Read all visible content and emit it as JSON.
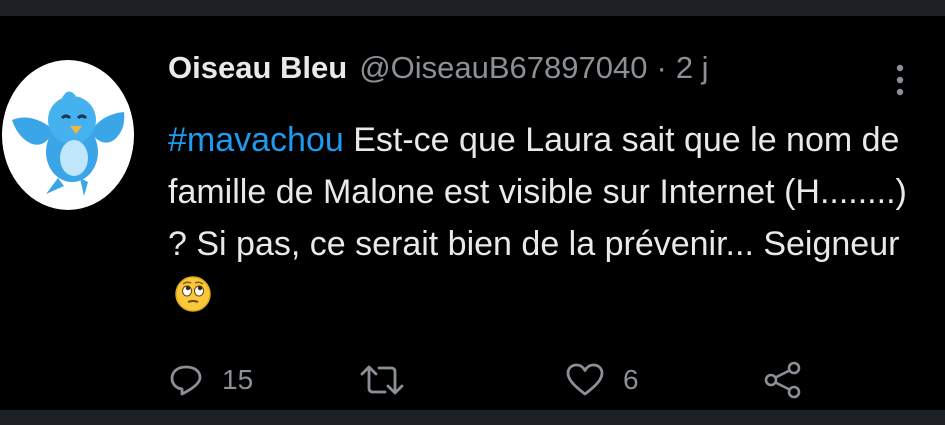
{
  "tweet": {
    "display_name": "Oiseau Bleu",
    "handle": "@OiseauB67897040",
    "separator": "·",
    "time": "2 j",
    "hashtag": "#mavachou",
    "text": " Est-ce que Laura sait que le nom de famille de Malone est visible sur Internet (H........) ? Si pas, ce serait bien de la prévenir... Seigneur",
    "emoji": "face-with-rolling-eyes-emoji"
  },
  "actions": {
    "reply_count": "15",
    "like_count": "6"
  },
  "icons": {
    "avatar": "blue-bird-avatar",
    "more": "more-vertical-icon",
    "reply": "reply-icon",
    "retweet": "retweet-icon",
    "like": "heart-icon",
    "share": "share-icon"
  },
  "colors": {
    "background": "#000000",
    "text": "#e7e9ea",
    "muted": "#8b9096",
    "accent": "#1d9bf0"
  }
}
